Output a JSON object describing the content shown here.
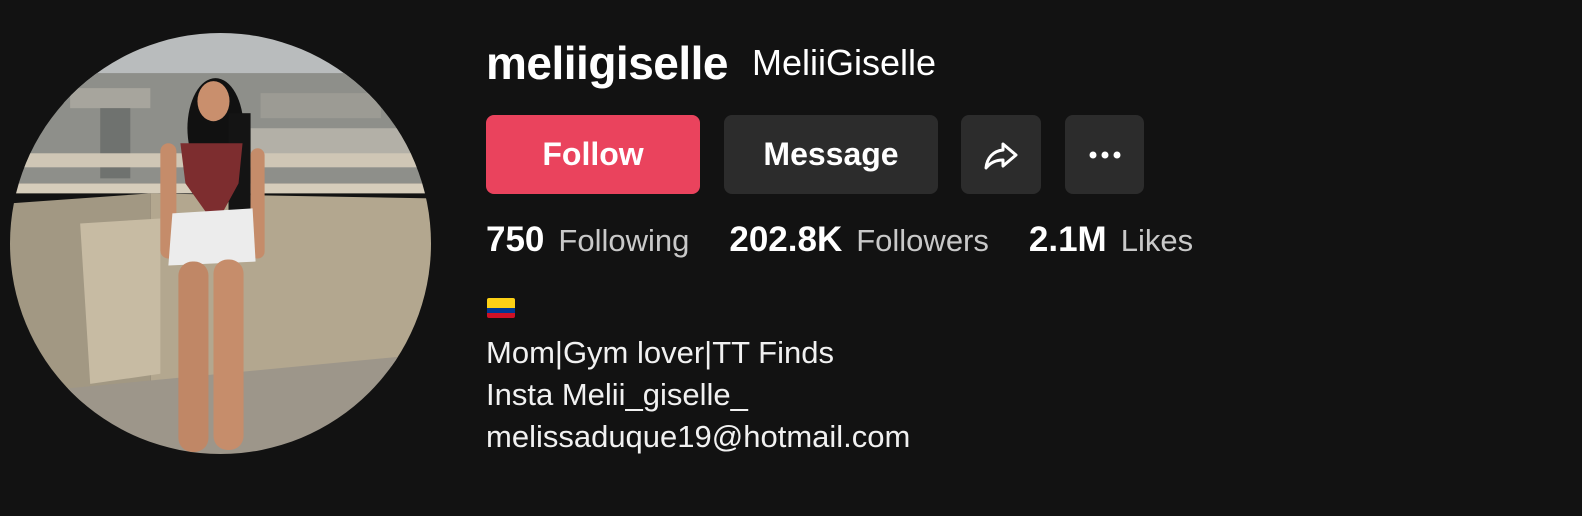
{
  "profile": {
    "username": "meliigiselle",
    "nickname": "MeliiGiselle",
    "avatar_alt": "profile photo"
  },
  "actions": {
    "follow_label": "Follow",
    "message_label": "Message",
    "share_icon": "share-icon",
    "more_icon": "more-icon"
  },
  "stats": [
    {
      "value": "750",
      "label": "Following"
    },
    {
      "value": "202.8K",
      "label": "Followers"
    },
    {
      "value": "2.1M",
      "label": "Likes"
    }
  ],
  "bio": {
    "flag_icon": "colombia-flag-icon",
    "lines": [
      "Mom|Gym lover|TT Finds",
      "Insta Melii_giselle_",
      "melissaduque19@hotmail.com"
    ]
  },
  "colors": {
    "background": "#121212",
    "follow_button": "#ea435d",
    "secondary_button": "#2c2c2c",
    "label_gray": "#c9c9c9"
  }
}
